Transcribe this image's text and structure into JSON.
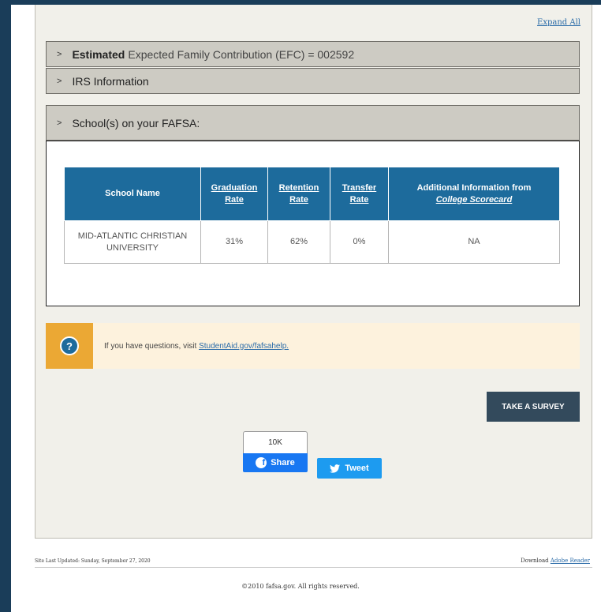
{
  "expand_all": "Expand All",
  "accordion": {
    "efc": {
      "bold": "Estimated",
      "rest": "Expected Family Contribution (EFC) = 002592"
    },
    "irs": {
      "label": "IRS Information"
    },
    "schools": {
      "label": "School(s) on your FAFSA:"
    }
  },
  "schools_table": {
    "headers": {
      "school_name": "School Name",
      "graduation_rate": [
        "Graduation",
        "Rate"
      ],
      "retention_rate": [
        "Retention",
        "Rate"
      ],
      "transfer_rate": [
        "Transfer",
        "Rate"
      ],
      "additional_info": "Additional Information from",
      "college_scorecard": "College Scorecard"
    },
    "rows": [
      {
        "school_name": [
          "MID-ATLANTIC CHRISTIAN",
          "UNIVERSITY"
        ],
        "graduation_rate": "31%",
        "retention_rate": "62%",
        "transfer_rate": "0%",
        "additional_info": "NA"
      }
    ]
  },
  "help": {
    "icon": "question-mark-icon",
    "text": "If you have questions, visit",
    "link": "StudentAid.gov/fafsahelp."
  },
  "survey_button": "TAKE A SURVEY",
  "social": {
    "fb_count": "10K",
    "fb_share": "Share",
    "tweet": "Tweet"
  },
  "footer": {
    "last_updated": "Site Last Updated: Sunday, September 27, 2020",
    "download_text": "Download",
    "download_link": "Adobe Reader",
    "copyright": "©2010 fafsa.gov. All rights reserved."
  },
  "colors": {
    "frame": "#1a3d59",
    "table_header": "#1d6b9c",
    "help_accent": "#eba834",
    "survey_button": "#334a5c",
    "facebook": "#1877f2",
    "twitter": "#1d9bf0"
  }
}
